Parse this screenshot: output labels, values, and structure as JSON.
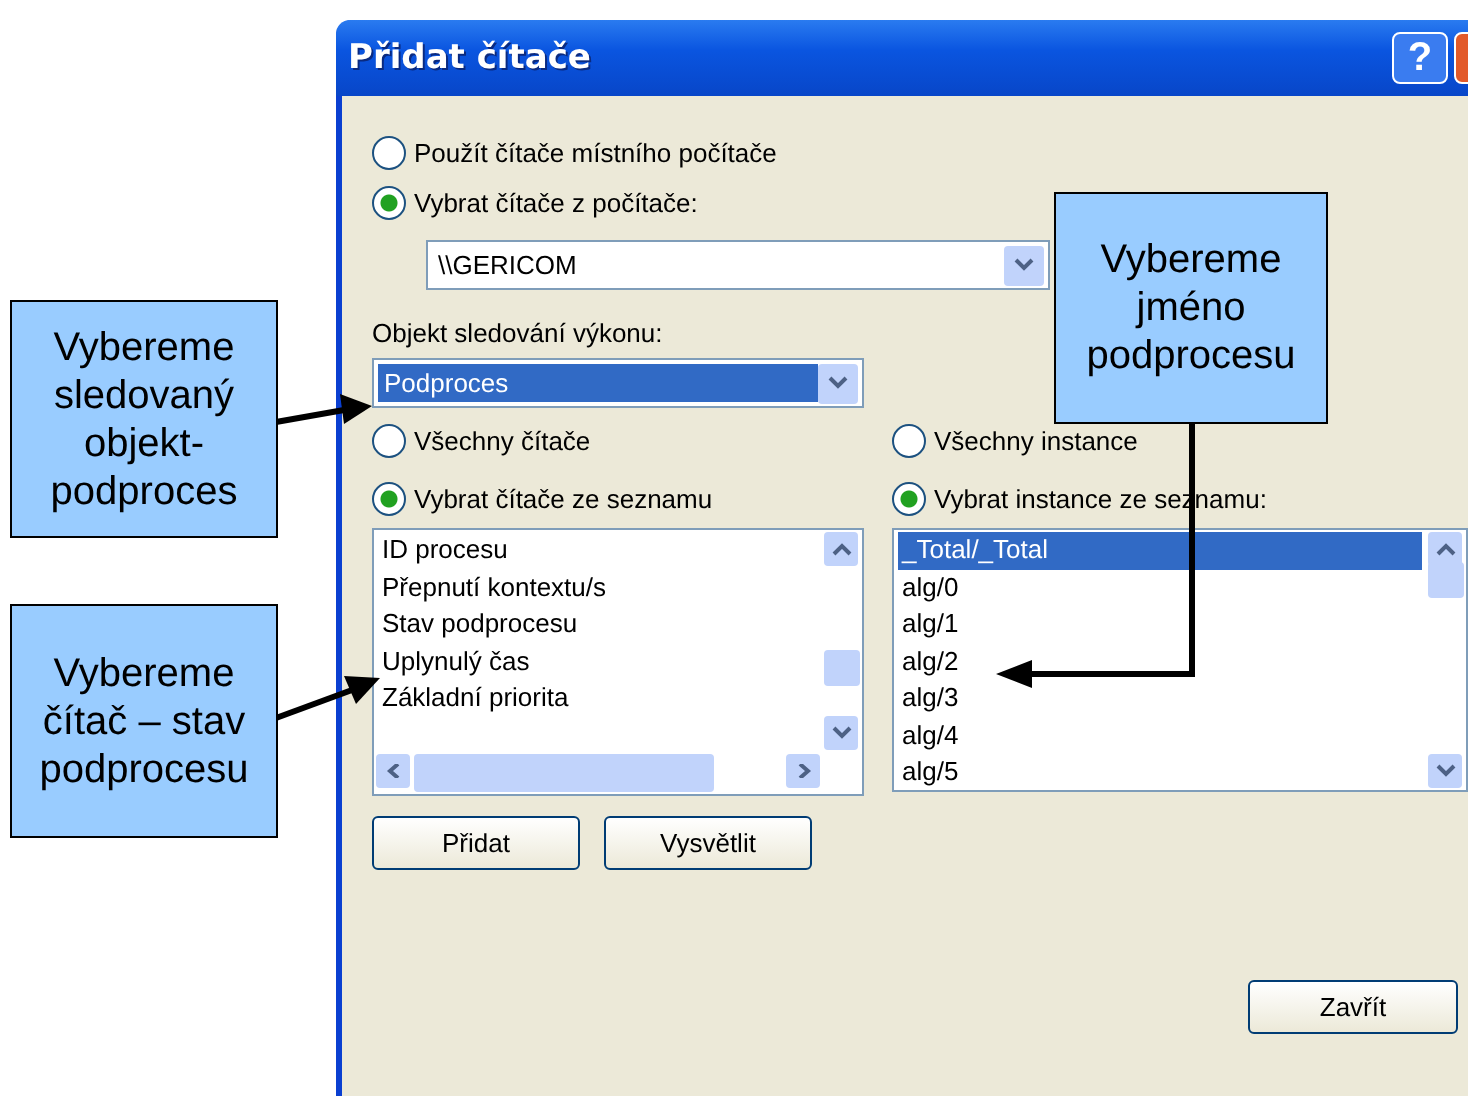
{
  "window": {
    "title": "Přidat čítače",
    "help_label": "?"
  },
  "source_options": [
    {
      "label": "Použít čítače místního počítače",
      "selected": false
    },
    {
      "label": "Vybrat čítače z počítače:",
      "selected": true
    }
  ],
  "computer_select": {
    "value": "\\\\GERICOM"
  },
  "object_label": "Objekt sledování výkonu:",
  "object_select": {
    "value": "Podproces",
    "selected": true
  },
  "counter_options": [
    {
      "label": "Všechny čítače",
      "selected": false
    },
    {
      "label": "Vybrat čítače ze seznamu",
      "selected": true
    }
  ],
  "instance_options": [
    {
      "label": "Všechny instance",
      "selected": false
    },
    {
      "label": "Vybrat instance ze seznamu:",
      "selected": true
    }
  ],
  "counters": [
    {
      "label": "ID procesu",
      "selected": false
    },
    {
      "label": "Přepnutí kontextu/s",
      "selected": false
    },
    {
      "label": "Stav podprocesu",
      "selected": false
    },
    {
      "label": "Uplynulý čas",
      "selected": false
    },
    {
      "label": "Základní priorita",
      "selected": false
    }
  ],
  "instances": [
    {
      "label": "_Total/_Total",
      "selected": true
    },
    {
      "label": "alg/0",
      "selected": false
    },
    {
      "label": "alg/1",
      "selected": false
    },
    {
      "label": "alg/2",
      "selected": false
    },
    {
      "label": "alg/3",
      "selected": false
    },
    {
      "label": "alg/4",
      "selected": false
    },
    {
      "label": "alg/5",
      "selected": false
    }
  ],
  "buttons": [
    "Přidat",
    "Vysvětlit"
  ],
  "close_button": "Zavřít",
  "callouts": [
    "Vybereme sledovaný objekt-podproces",
    "Vybereme čítač – stav podprocesu",
    "Vybereme jméno podprocesu"
  ]
}
